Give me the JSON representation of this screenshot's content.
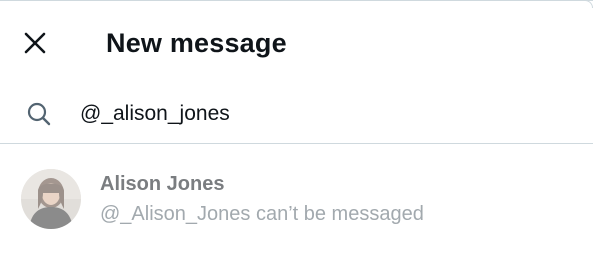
{
  "header": {
    "title": "New message",
    "close_icon": "close-icon"
  },
  "search": {
    "icon": "search-icon",
    "value": "@_alison_jones"
  },
  "results": [
    {
      "name": "Alison Jones",
      "status": "@_Alison_Jones can’t be messaged",
      "avatar": "avatar"
    }
  ],
  "colors": {
    "text_primary": "#0f1419",
    "text_disabled_name": "#7a7d80",
    "text_disabled_sub": "#a2a9ae",
    "divider": "#cfd9de"
  }
}
